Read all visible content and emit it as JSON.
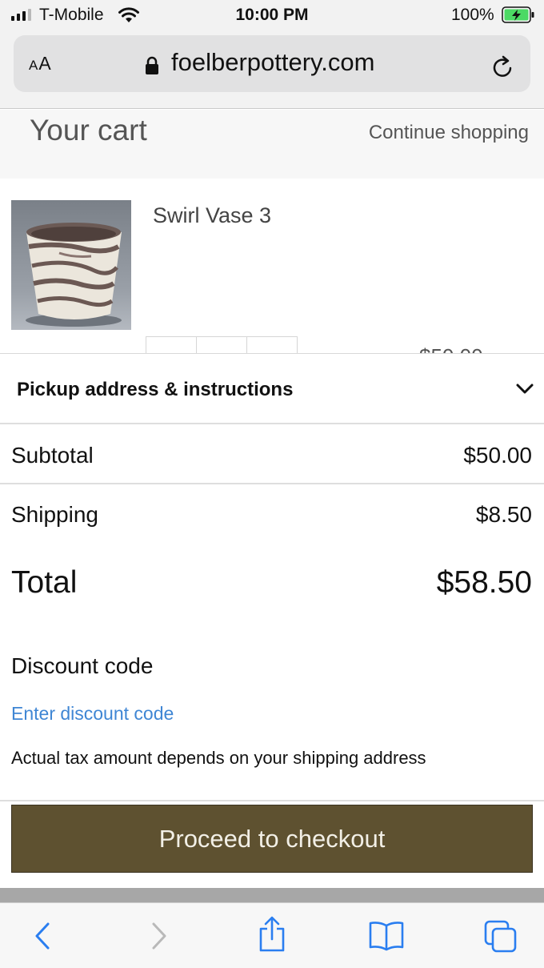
{
  "status_bar": {
    "carrier": "T-Mobile",
    "time": "10:00 PM",
    "battery": "100%",
    "icons": [
      "cellular-signal-icon",
      "wifi-icon",
      "battery-charging-icon"
    ]
  },
  "browser": {
    "text_size_button": {
      "small": "A",
      "large": "A"
    },
    "domain": "foelberpottery.com",
    "icons": [
      "lock-icon",
      "reload-icon"
    ]
  },
  "cart": {
    "title": "Your cart",
    "continue_label": "Continue shopping"
  },
  "product": {
    "name": "Swirl Vase 3",
    "price_partial": "$50.00"
  },
  "summary": {
    "pickup_label": "Pickup address & instructions",
    "subtotal_label": "Subtotal",
    "subtotal_value": "$50.00",
    "shipping_label": "Shipping",
    "shipping_value": "$8.50",
    "total_label": "Total",
    "total_value": "$58.50",
    "discount_title": "Discount code",
    "discount_link": "Enter discount code",
    "tax_note": "Actual tax amount depends on your shipping address",
    "checkout_label": "Proceed to checkout"
  },
  "colors": {
    "checkout_bg": "#5e5130",
    "link": "#3f86d4",
    "ios_blue": "#2a7ef0"
  },
  "toolbar": {
    "icons": [
      "back-icon",
      "forward-icon",
      "share-icon",
      "bookmarks-icon",
      "tabs-icon"
    ]
  }
}
